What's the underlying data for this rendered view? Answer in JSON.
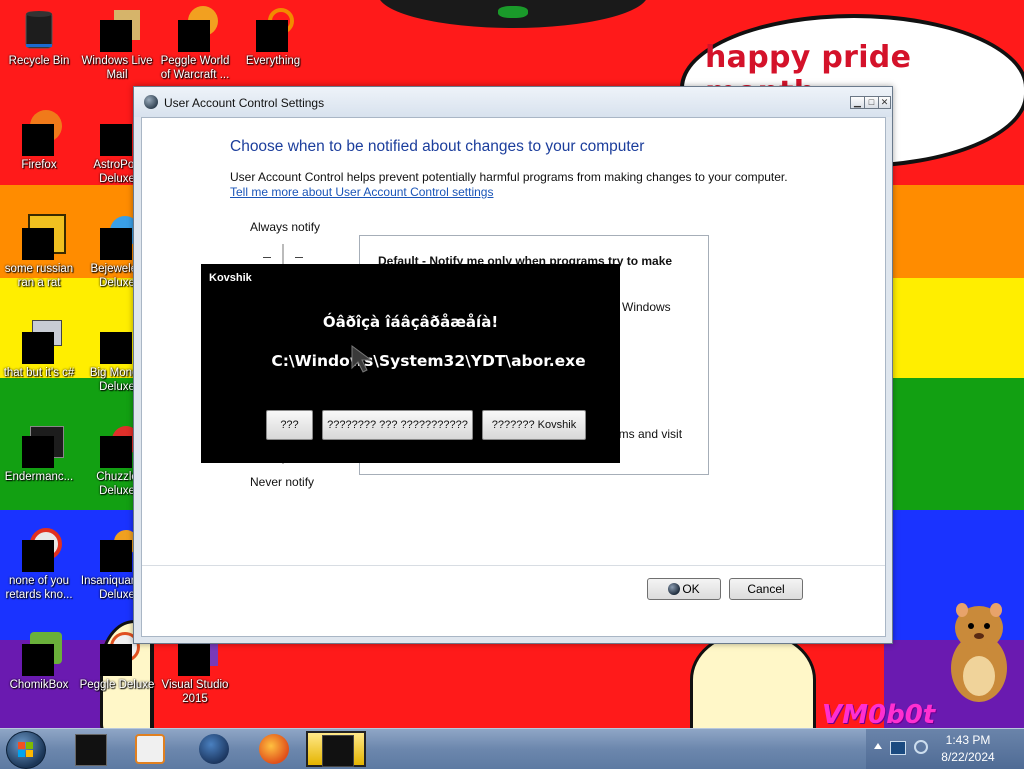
{
  "wallpaper": {
    "speech_text": "happy pride month",
    "signature": "VM0b0t",
    "colors": {
      "red": "#ff1a1a",
      "orange": "#ff8c00",
      "yellow": "#ffee00",
      "green": "#12a012",
      "blue": "#1a33ff",
      "purple": "#6a1ab0"
    }
  },
  "desktop_icons": [
    {
      "label": "Recycle Bin",
      "icon": "recycle-bin-icon"
    },
    {
      "label": "Windows Live Mail",
      "icon": "windows-live-mail-icon"
    },
    {
      "label": "Peggle World of Warcraft ...",
      "icon": "peggle-wow-icon"
    },
    {
      "label": "Everything",
      "icon": "everything-search-icon"
    },
    {
      "label": "Firefox",
      "icon": "firefox-icon"
    },
    {
      "label": "AstroPop Deluxe",
      "icon": "astropop-icon"
    },
    {
      "label": "some russian ran a rat",
      "icon": "ae-app-icon"
    },
    {
      "label": "Bejeweled Deluxe",
      "icon": "bejeweled-icon"
    },
    {
      "label": "that but it's c#",
      "icon": "stacked-windows-icon"
    },
    {
      "label": "Big Money Deluxe",
      "icon": "big-money-icon"
    },
    {
      "label": "Endermanc...",
      "icon": "terminal-icon"
    },
    {
      "label": "Chuzzle Deluxe",
      "icon": "chuzzle-icon"
    },
    {
      "label": "none of you retards kno...",
      "icon": "chrome-like-icon"
    },
    {
      "label": "Insaniquarium Deluxe",
      "icon": "insaniquarium-icon"
    },
    {
      "label": "ChomikBox",
      "icon": "chomikbox-icon"
    },
    {
      "label": "Peggle Deluxe",
      "icon": "peggle-icon"
    },
    {
      "label": "Visual Studio 2015",
      "icon": "visual-studio-icon"
    }
  ],
  "uac": {
    "title": "User Account Control Settings",
    "heading": "Choose when to be notified about changes to your computer",
    "description": "User Account Control helps prevent potentially harmful programs from making changes to your computer.",
    "link": "Tell me more about User Account Control settings",
    "always_label": "Always notify",
    "never_label": "Never notify",
    "box_heading": "Default - Notify me only when programs try to make",
    "box_windows": "Windows",
    "box_visit": "rams and visit",
    "ok_label": "OK",
    "cancel_label": "Cancel",
    "window_controls": [
      "minimize",
      "maximize",
      "close"
    ]
  },
  "popup": {
    "title": "Kovshik",
    "message": "Óâðîçà îáâçâðåæåíà!",
    "path": "C:\\Windows\\System32\\YDT\\abor.exe",
    "buttons": [
      "???",
      "???????? ??? ???????????",
      "??????? Kovshik"
    ]
  },
  "taskbar": {
    "apps": [
      "cmd-like-icon",
      "media-player-icon",
      "globe-icon",
      "firefox-icon",
      "active-window-icon"
    ],
    "tray_icons": [
      "tray-arrow-icon",
      "network-icon",
      "volume-icon"
    ],
    "time": "1:43 PM",
    "date": "8/22/2024"
  }
}
